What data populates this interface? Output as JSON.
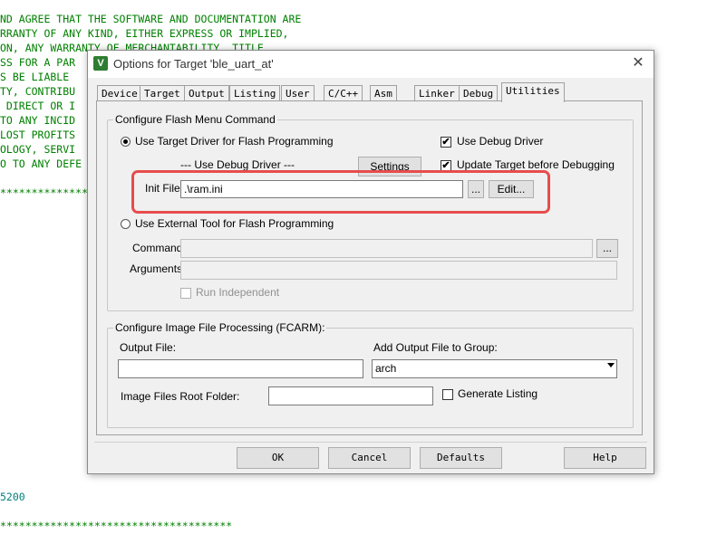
{
  "editor": {
    "lines": [
      "ND AGREE THAT THE SOFTWARE AND DOCUMENTATION ARE",
      "RRANTY OF ANY KIND, EITHER EXPRESS OR IMPLIED,",
      "ON, ANY WARRANTY OF MERCHANTABILITY, TITLE,",
      "SS FOR A PAR",
      "S BE LIABLE",
      "TY, CONTRIBU",
      " DIRECT OR I",
      "TO ANY INCID",
      "LOST PROFITS",
      "OLOGY, SERVI",
      "O TO ANY DEFE",
      "****************",
      "5200",
      "*************************************"
    ]
  },
  "dialog": {
    "title": "Options for Target 'ble_uart_at'",
    "app_icon": "V",
    "close_glyph": "✕",
    "tabs": [
      "Device",
      "Target",
      "Output",
      "Listing",
      "User",
      "C/C++",
      "Asm",
      "Linker",
      "Debug",
      "Utilities"
    ],
    "flash_group": {
      "label": "Configure Flash Menu Command",
      "use_target_driver": "Use Target Driver for Flash Programming",
      "driver_value": "--- Use Debug Driver ---",
      "settings_button": "Settings",
      "use_debug_driver": "Use Debug Driver",
      "update_target": "Update Target before Debugging",
      "init_file_label": "Init File:",
      "init_file_value": ".\\ram.ini",
      "browse_button": "...",
      "edit_button": "Edit...",
      "use_external_tool": "Use External Tool for Flash Programming",
      "command_label": "Command:",
      "command_browse": "...",
      "arguments_label": "Arguments:",
      "run_independent": "Run Independent",
      "check_mark": "✔"
    },
    "image_group": {
      "label": "Configure Image File Processing (FCARM):",
      "output_file_label": "Output File:",
      "output_file_value": "",
      "add_output_label": "Add Output File  to Group:",
      "group_value": "arch",
      "root_folder_label": "Image Files Root Folder:",
      "root_folder_value": "",
      "generate_listing": "Generate Listing"
    },
    "buttons": {
      "ok": "OK",
      "cancel": "Cancel",
      "defaults": "Defaults",
      "help": "Help"
    }
  }
}
